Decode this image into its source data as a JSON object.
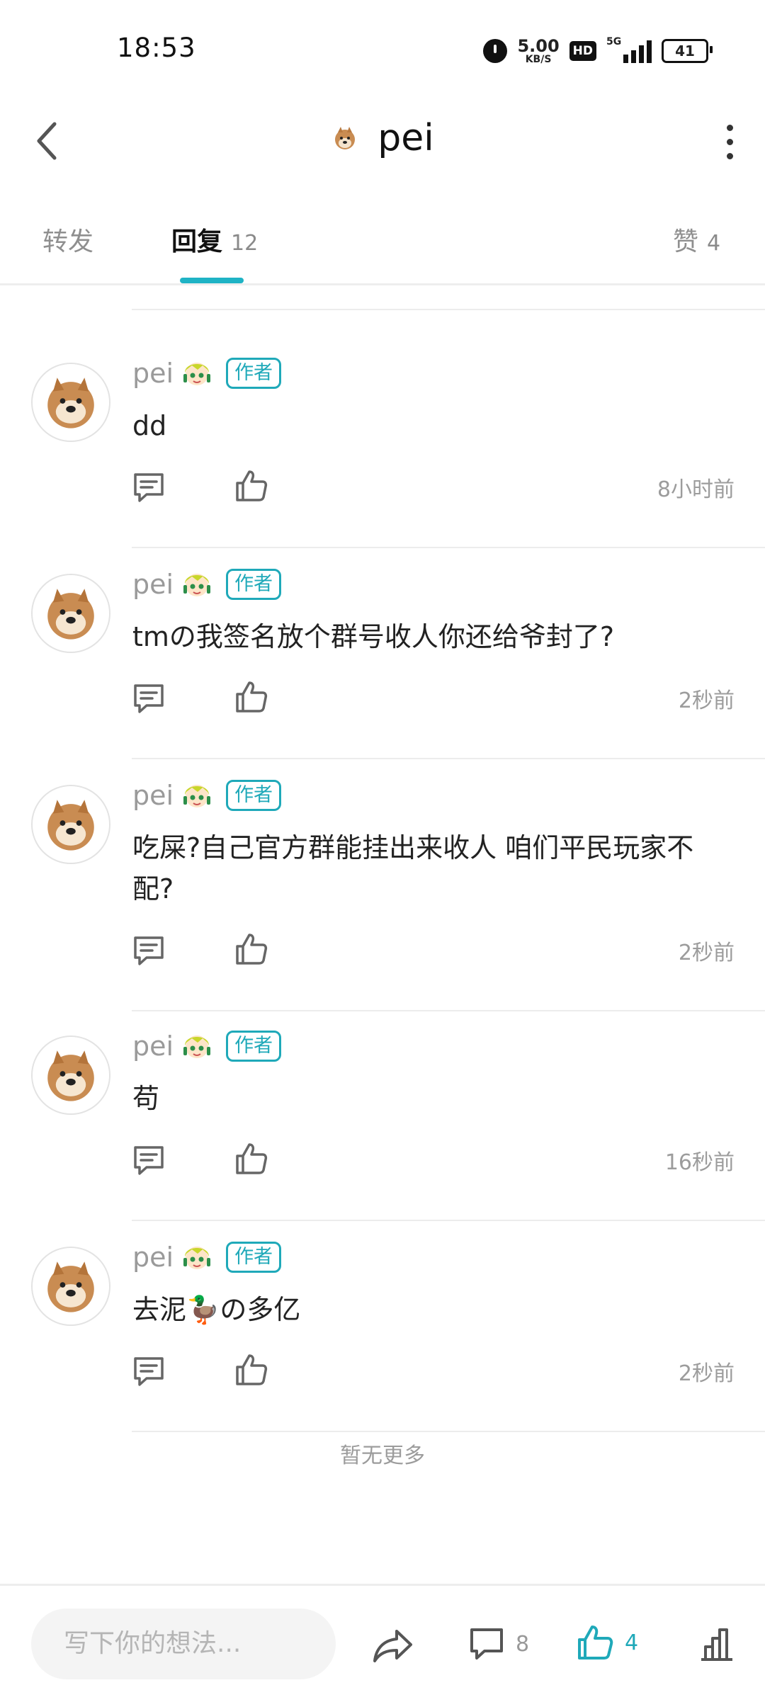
{
  "status_bar": {
    "time": "18:53",
    "net_speed_value": "5.00",
    "net_speed_unit": "KB/S",
    "hd_label": "HD",
    "network_type": "5G",
    "battery": "41"
  },
  "header": {
    "title": "pei"
  },
  "tabs": [
    {
      "label": "转发",
      "count": ""
    },
    {
      "label": "回复",
      "count": "12"
    },
    {
      "label": "赞",
      "count": "4"
    }
  ],
  "comments": [
    {
      "name": "pei",
      "badge": "作者",
      "text": "dd",
      "time": "8小时前"
    },
    {
      "name": "pei",
      "badge": "作者",
      "text": "tmの我签名放个群号收人你还给爷封了?",
      "time": "2秒前"
    },
    {
      "name": "pei",
      "badge": "作者",
      "text": "吃屎?自己官方群能挂出来收人 咱们平民玩家不配?",
      "time": "2秒前"
    },
    {
      "name": "pei",
      "badge": "作者",
      "text": "苟",
      "time": "16秒前"
    },
    {
      "name": "pei",
      "badge": "作者",
      "text": "去泥🦆の多亿",
      "time": "2秒前"
    }
  ],
  "no_more": "暂无更多",
  "bottom_bar": {
    "input_placeholder": "写下你的想法...",
    "comment_count": "8",
    "like_count": "4"
  },
  "colors": {
    "accent": "#1fb3c5",
    "muted_text": "#9c9c9c"
  }
}
